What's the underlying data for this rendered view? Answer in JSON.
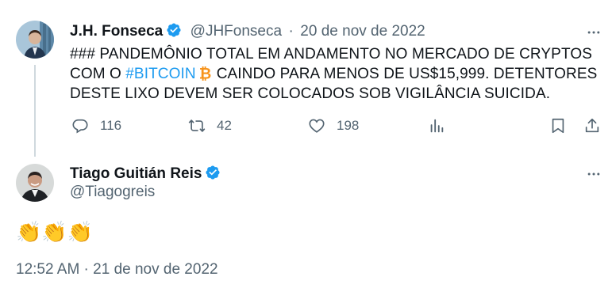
{
  "original_tweet": {
    "author_name": "J.H. Fonseca",
    "handle": "@JHFonseca",
    "separator": "·",
    "date": "20 de nov de 2022",
    "text_line1": "### PANDEMÔNIO TOTAL EM ANDAMENTO NO MERCADO DE CRYPTOS",
    "text_pre_hashtag": "COM O ",
    "hashtag": "#BITCOIN",
    "text_post_hashtag": "CAINDO PARA MENOS DE US$15,999. DETENTORES",
    "text_line3": "DESTE LIXO DEVEM SER COLOCADOS SOB VIGILÂNCIA SUICIDA.",
    "replies": "116",
    "retweets": "42",
    "likes": "198"
  },
  "reply_tweet": {
    "author_name": "Tiago Guitián Reis",
    "handle": "@Tiagogreis",
    "body": "👏👏👏",
    "timestamp": "12:52 AM · 21 de nov de 2022"
  },
  "colors": {
    "accent": "#1d9bf0",
    "muted": "#536471",
    "text": "#0f1419",
    "bitcoin": "#f7931a",
    "thread_line": "#cfd9de"
  },
  "icons": [
    "verified-badge-icon",
    "more-icon",
    "reply-icon",
    "retweet-icon",
    "like-icon",
    "views-icon",
    "bookmark-icon",
    "share-icon",
    "bitcoin-icon"
  ]
}
